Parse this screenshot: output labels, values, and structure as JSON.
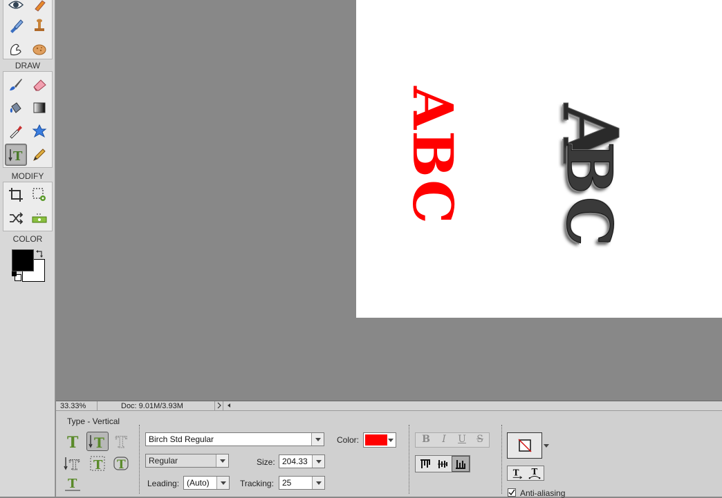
{
  "toolbox": {
    "sections": {
      "draw": "DRAW",
      "modify": "MODIFY",
      "color": "COLOR"
    },
    "colors": {
      "foreground": "#000000",
      "background": "#ffffff"
    }
  },
  "canvas": {
    "red_text": "ABC",
    "red_text_color": "#ff0000",
    "styled_text_a": "A",
    "styled_text_bc": "BC"
  },
  "statusbar": {
    "zoom": "33.33%",
    "doc_info": "Doc: 9.01M/3.93M"
  },
  "options": {
    "tool_name": "Type - Vertical",
    "font_family": "Birch Std Regular",
    "font_style": "Regular",
    "color_label": "Color:",
    "color_value": "#ff0000",
    "size_label": "Size:",
    "size_value": "204.33",
    "leading_label": "Leading:",
    "leading_value": "(Auto)",
    "tracking_label": "Tracking:",
    "tracking_value": "25",
    "format_buttons": [
      "B",
      "I",
      "U",
      "S"
    ],
    "anti_aliasing_label": "Anti-aliasing",
    "anti_aliasing_checked": true
  }
}
